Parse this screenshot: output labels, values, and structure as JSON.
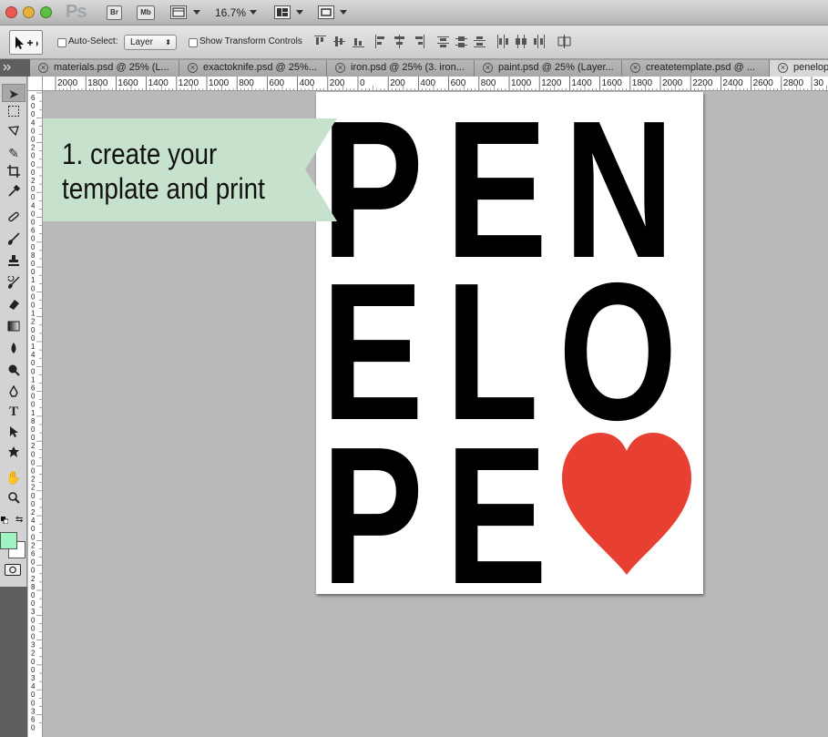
{
  "app": {
    "logo": "Ps",
    "bridge_label": "Br",
    "minibridge_label": "Mb",
    "zoom": "16.7%"
  },
  "options": {
    "auto_select_label": "Auto-Select:",
    "auto_select_value": "Layer",
    "show_transform_label": "Show Transform Controls"
  },
  "tabs": [
    {
      "label": "materials.psd @ 25% (L..."
    },
    {
      "label": "exactoknife.psd @ 25%..."
    },
    {
      "label": "iron.psd @ 25% (3. iron..."
    },
    {
      "label": "paint.psd @ 25% (Layer..."
    },
    {
      "label": "createtemplate.psd @ ..."
    },
    {
      "label": "penelop"
    }
  ],
  "ruler": {
    "h_labels": [
      "2000",
      "1800",
      "1600",
      "1400",
      "1200",
      "1000",
      "800",
      "600",
      "400",
      "200",
      "0",
      "200",
      "400",
      "600",
      "800",
      "1000",
      "1200",
      "1400",
      "1600",
      "1800",
      "2000",
      "2200",
      "2400",
      "2600",
      "2800",
      "30"
    ],
    "v_labels": [
      "6",
      "0",
      "0",
      "4",
      "0",
      "0",
      "2",
      "0",
      "0",
      "0",
      "2",
      "0",
      "0",
      "4",
      "0",
      "0",
      "6",
      "0",
      "0",
      "8",
      "0",
      "0",
      "1",
      "0",
      "0",
      "0",
      "1",
      "2",
      "0",
      "0",
      "1",
      "4",
      "0",
      "0",
      "1",
      "6",
      "0",
      "0",
      "1",
      "8",
      "0",
      "0",
      "2",
      "0",
      "0",
      "0",
      "2",
      "2",
      "0",
      "0",
      "2",
      "4",
      "0",
      "0",
      "2",
      "6",
      "0",
      "0",
      "2",
      "8",
      "0",
      "0",
      "3",
      "0",
      "0",
      "0",
      "3",
      "2",
      "0",
      "0",
      "3",
      "4",
      "0",
      "0",
      "3",
      "6",
      "0"
    ]
  },
  "banner": {
    "line1": "1. create your",
    "line2": "template and print",
    "color": "#c6e2cc"
  },
  "artwork": {
    "row1": [
      "P",
      "E",
      "N"
    ],
    "row2": [
      "E",
      "L",
      "O"
    ],
    "row3": [
      "P",
      "E"
    ],
    "heart_color": "#e74032",
    "heart": "heart-icon"
  },
  "colors": {
    "foreground": "#9ff2c2",
    "background": "#ffffff"
  }
}
